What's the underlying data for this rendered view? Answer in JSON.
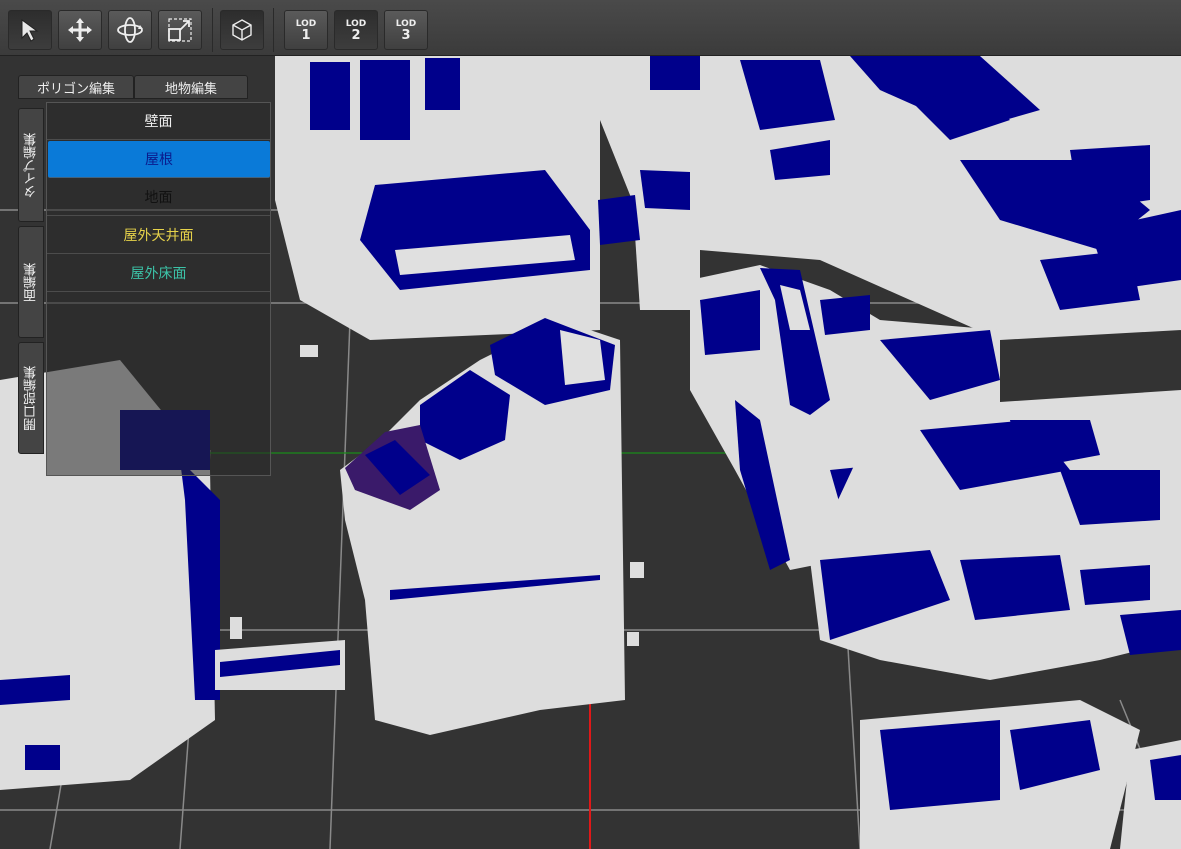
{
  "toolbar": {
    "tools": [
      {
        "icon": "select-arrow-icon",
        "active": true
      },
      {
        "icon": "move-icon",
        "active": false
      },
      {
        "icon": "rotate-icon",
        "active": false
      },
      {
        "icon": "scale-icon",
        "active": false
      },
      {
        "icon": "view-cube-icon",
        "active": true
      }
    ],
    "lod": [
      {
        "top": "LOD",
        "num": "1",
        "active": false
      },
      {
        "top": "LOD",
        "num": "2",
        "active": true
      },
      {
        "top": "LOD",
        "num": "3",
        "active": false
      }
    ]
  },
  "top_tabs": [
    {
      "label": "ポリゴン編集"
    },
    {
      "label": "地物編集"
    }
  ],
  "side_tabs": [
    {
      "label": "タイプ編集"
    },
    {
      "label": "面編集"
    },
    {
      "label": "開口部編集"
    }
  ],
  "type_list": [
    {
      "label": "壁面",
      "color": "#eeeeee",
      "selected": false
    },
    {
      "label": "屋根",
      "color": "#0a1a8c",
      "selected": true
    },
    {
      "label": "地面",
      "color": "#111111",
      "selected": false
    },
    {
      "label": "屋外天井面",
      "color": "#e6d24a",
      "selected": false
    },
    {
      "label": "屋外床面",
      "color": "#3cc3a8",
      "selected": false
    }
  ],
  "scene": {
    "wall_color": "#dddddd",
    "roof_color": "#00008b",
    "ground_color": "#333333",
    "grid_color": "#8a8a8a",
    "axis_x_color": "#1a8a1a",
    "axis_z_color": "#e01818",
    "highlight_color": "#3a1a6a"
  }
}
